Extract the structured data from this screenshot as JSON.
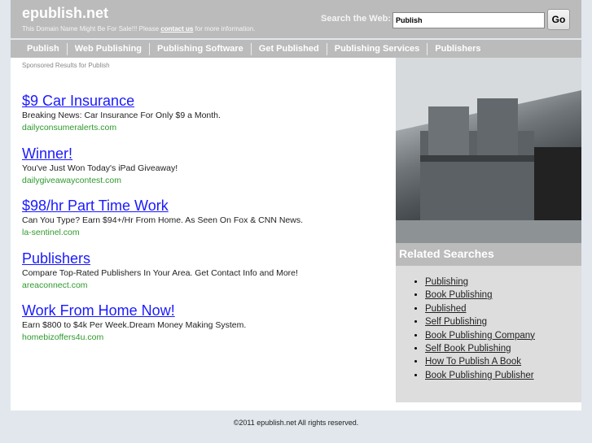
{
  "header": {
    "title": "epublish.net",
    "tagline_before": "This Domain Name Might Be For Sale!!! Please",
    "tagline_link": "contact us",
    "tagline_after": "for more information.",
    "search_label": "Search the Web:",
    "search_value": "Publish",
    "go_label": "Go"
  },
  "nav": [
    "Publish",
    "Web Publishing",
    "Publishing Software",
    "Get Published",
    "Publishing Services",
    "Publishers"
  ],
  "sponsored": "Sponsored Results for Publish",
  "ads": [
    {
      "title": "$9 Car Insurance",
      "desc": "Breaking News: Car Insurance For Only $9 a Month.",
      "url": "dailyconsumeralerts.com"
    },
    {
      "title": "Winner!",
      "desc": "You've Just Won Today's iPad Giveaway!",
      "url": "dailygiveawaycontest.com"
    },
    {
      "title": "$98/hr Part Time Work",
      "desc": "Can You Type? Earn $94+/Hr From Home. As Seen On Fox & CNN News.",
      "url": "la-sentinel.com"
    },
    {
      "title": "Publishers",
      "desc": "Compare Top-Rated Publishers In Your Area. Get Contact Info and More!",
      "url": "areaconnect.com"
    },
    {
      "title": "Work From Home Now!",
      "desc": "Earn $800 to $4k Per Week.Dream Money Making System.",
      "url": "homebizoffers4u.com"
    }
  ],
  "related": {
    "title": "Related Searches",
    "items": [
      "Publishing",
      "Book Publishing",
      "Published",
      "Self Publishing",
      "Book Publishing Company",
      "Self Book Publishing",
      "How To Publish A Book",
      "Book Publishing Publisher"
    ]
  },
  "footer": "©2011 epublish.net All rights reserved.",
  "colors": {
    "header": "#bbbbbb",
    "ad_title": "#1a1aff",
    "ad_url": "#2d9a2d",
    "background": "#e1e7ed"
  }
}
